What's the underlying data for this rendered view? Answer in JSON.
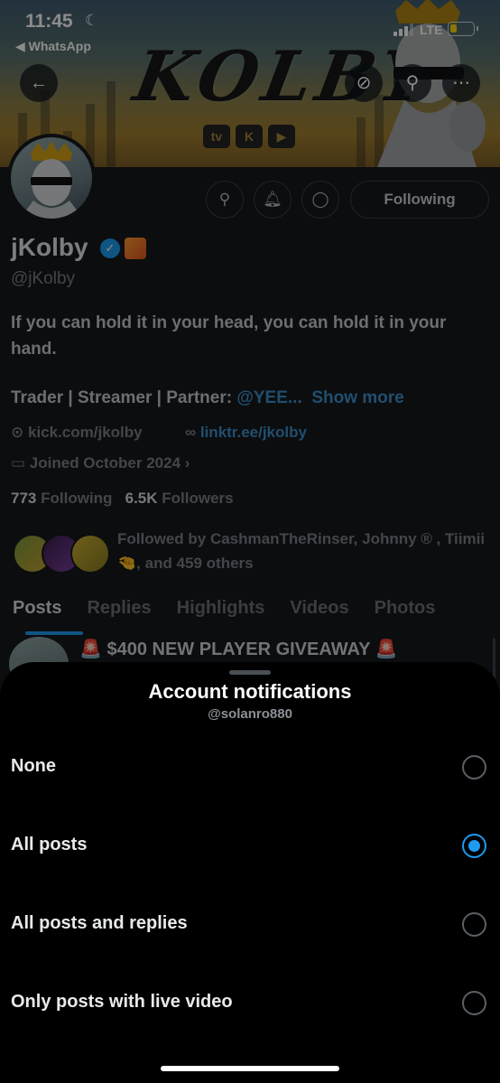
{
  "status_bar": {
    "time": "11:45",
    "back_app": "◀ WhatsApp",
    "network": "LTE",
    "battery_level": 0.3
  },
  "banner": {
    "logo_text": "KOLBY",
    "platforms": [
      "twitch",
      "kick",
      "youtube"
    ]
  },
  "profile": {
    "name": "jKolby",
    "handle": "@jKolby",
    "bio_line1": "If you can hold it in your head, you can hold it in your hand.",
    "bio_line2_prefix": "Trader | Streamer | Partner: ",
    "bio_line2_mention": "@YEE...",
    "show_more": "Show more",
    "location": "kick.com/jkolby",
    "website": "linktr.ee/jkolby",
    "joined": "Joined October 2024",
    "following_count": "773",
    "following_label": "Following",
    "followers_count": "6.5K",
    "followers_label": "Followers",
    "followed_by": "Followed by CashmanTheRinser, Johnny ® , Tiimii🤏, and 459 others",
    "following_button": "Following"
  },
  "tabs": [
    "Posts",
    "Replies",
    "Highlights",
    "Videos",
    "Photos"
  ],
  "pinned_post_text": "🚨 $400 NEW PLAYER GIVEAWAY 🚨",
  "sheet": {
    "title": "Account notifications",
    "subtitle": "@solanro880",
    "options": [
      {
        "label": "None",
        "selected": false
      },
      {
        "label": "All posts",
        "selected": true
      },
      {
        "label": "All posts and replies",
        "selected": false
      },
      {
        "label": "Only posts with live video",
        "selected": false
      }
    ]
  },
  "colors": {
    "accent": "#1d9bf0",
    "sheet_bg": "#000000"
  }
}
